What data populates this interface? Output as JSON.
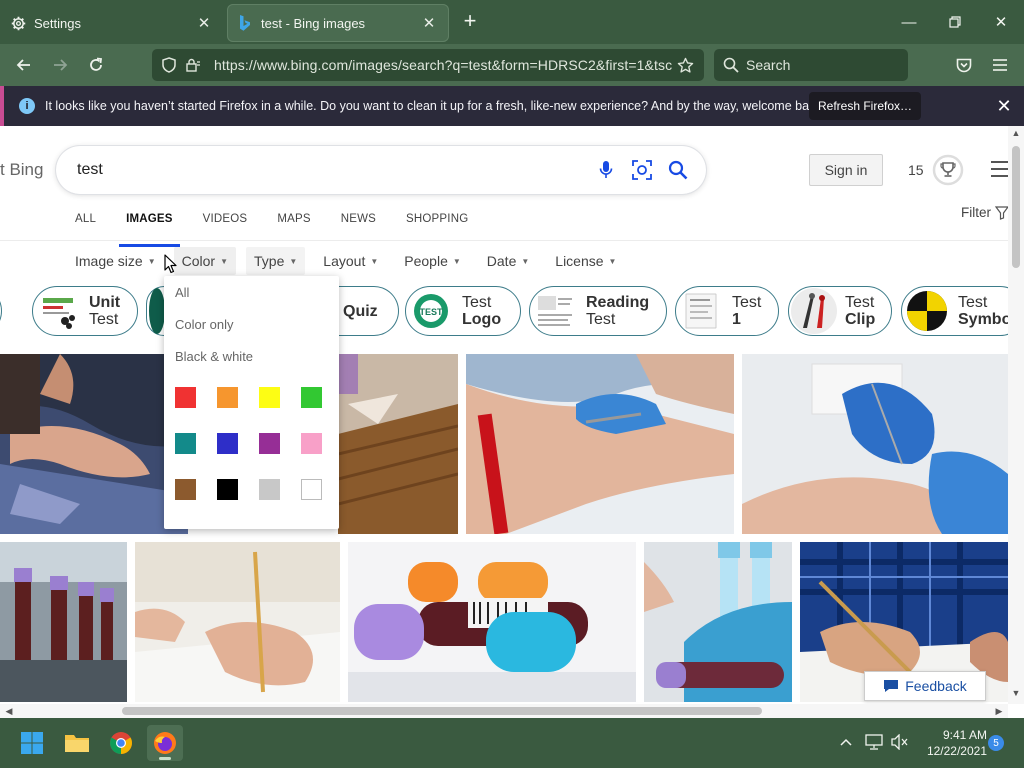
{
  "browser": {
    "tabs": [
      {
        "label": "Settings",
        "icon": "gear-icon"
      },
      {
        "label": "test - Bing images",
        "icon": "bing-icon"
      }
    ],
    "url": "https://www.bing.com/images/search?q=test&form=HDRSC2&first=1&tsc",
    "search_placeholder": "Search"
  },
  "notification": {
    "text": "It looks like you haven’t started Firefox in a while. Do you want to clean it up for a fresh, like-new experience? And by the way, welcome back!",
    "button": "Refresh Firefox…"
  },
  "bing": {
    "logo_fragment": "t Bing",
    "query": "test",
    "sign_in": "Sign in",
    "rewards_count": "15",
    "scopes": [
      "ALL",
      "IMAGES",
      "VIDEOS",
      "MAPS",
      "NEWS",
      "SHOPPING"
    ],
    "active_scope": "IMAGES",
    "filter_label": "Filter",
    "filters": [
      "Image size",
      "Color",
      "Type",
      "Layout",
      "People",
      "Date",
      "License"
    ],
    "chips": [
      {
        "line1": "t",
        "line2": ""
      },
      {
        "line1": "Unit",
        "line2": "Test"
      },
      {
        "line1": "Quiz",
        "line2": ""
      },
      {
        "line1": "Test",
        "line2": "Logo"
      },
      {
        "line1": "Reading",
        "line2": "Test"
      },
      {
        "line1": "Test",
        "line2": "1"
      },
      {
        "line1": "Test",
        "line2": "Clip"
      },
      {
        "line1": "Test",
        "line2": "Symbo"
      }
    ],
    "color_menu": {
      "options": [
        "All",
        "Color only",
        "Black & white"
      ],
      "swatches": [
        "#f03232",
        "#f6962e",
        "#fdfd14",
        "#32c832",
        "#138a8a",
        "#2e2ec8",
        "#962e96",
        "#f8a0c8",
        "#8c5a2e",
        "#000000",
        "#c8c8c8",
        "#ffffff"
      ]
    },
    "feedback": "Feedback"
  },
  "taskbar": {
    "time": "9:41 AM",
    "date": "12/22/2021",
    "notification_count": "5"
  }
}
